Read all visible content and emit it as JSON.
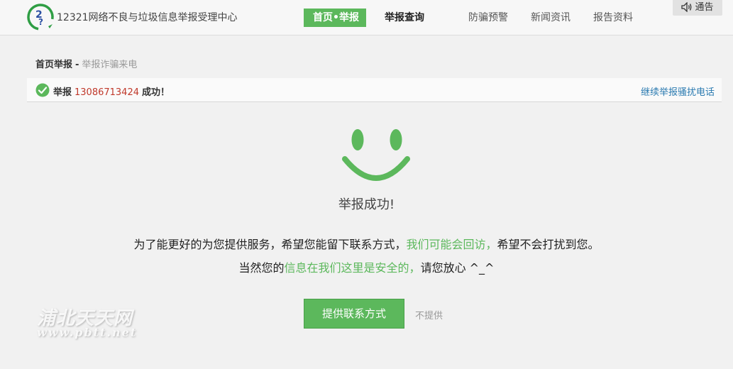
{
  "header": {
    "site_title": "12321网络不良与垃圾信息举报受理中心",
    "nav": [
      {
        "label": "首页•举报"
      },
      {
        "label": "举报查询"
      },
      {
        "label": "防骗预警"
      },
      {
        "label": "新闻资讯"
      },
      {
        "label": "报告资料"
      }
    ],
    "notice_label": "通告"
  },
  "breadcrumb": {
    "home": "首页举报",
    "separator": "-",
    "current": "举报诈骗来电"
  },
  "success_bar": {
    "prefix": "举报",
    "phone": "13086713424",
    "suffix": "成功！",
    "continue_link": "继续举报骚扰电话"
  },
  "result": {
    "title": "举报成功!",
    "line1_a": "为了能更好的为您提供服务，希望您能留下联系方式，",
    "line1_highlight": "我们可能会回访，",
    "line1_b": "希望不会打扰到您。",
    "line2_a": "当然您的",
    "line2_highlight": "信息在我们这里是安全的，",
    "line2_b": "请您放心 ^_^"
  },
  "actions": {
    "provide_label": "提供联系方式",
    "decline_label": "不提供"
  },
  "watermark": {
    "name": "浦北天天网",
    "url": "www.pbtt.net"
  },
  "colors": {
    "accent_green": "#5cb85c",
    "phone_red": "#c0392b",
    "link_blue": "#2a7ab0"
  }
}
